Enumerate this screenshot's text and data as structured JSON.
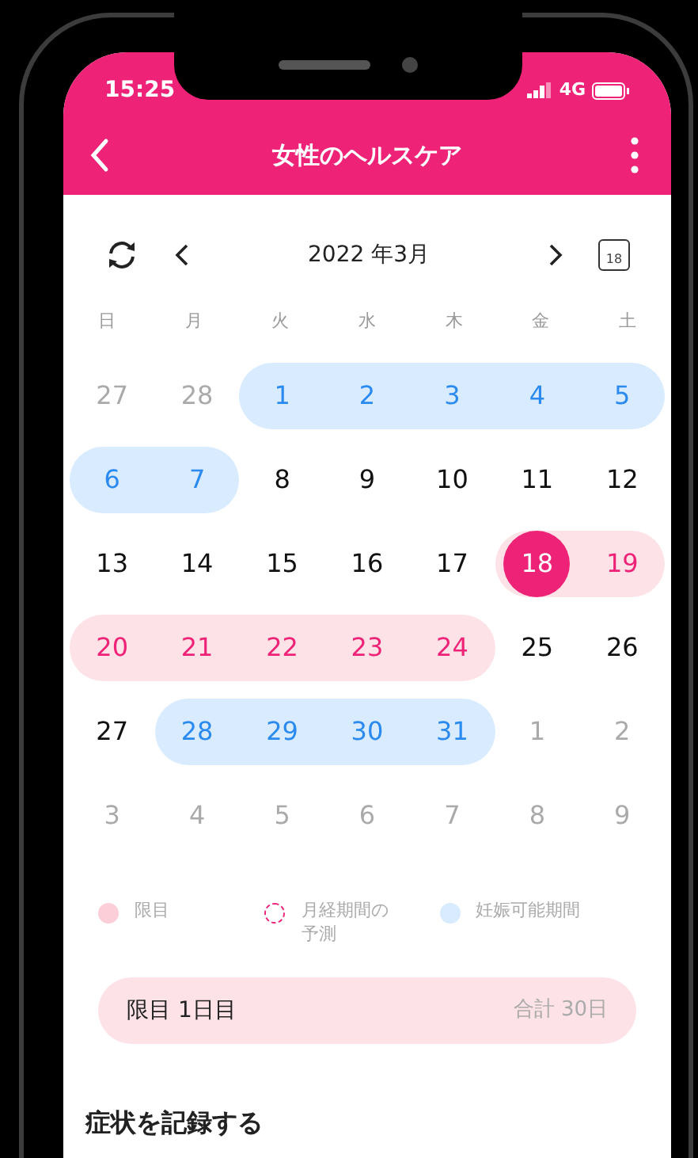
{
  "status_bar": {
    "time": "15:25",
    "network": "4G"
  },
  "header": {
    "title": "女性のヘルスケア"
  },
  "calendar": {
    "month": "2022 年3月",
    "today_icon": "18",
    "weekdays": [
      "日",
      "月",
      "火",
      "水",
      "木",
      "金",
      "土"
    ],
    "weeks": [
      [
        {
          "label": "27",
          "kind": "other",
          "selected": false
        },
        {
          "label": "28",
          "kind": "other",
          "selected": false
        },
        {
          "label": "1",
          "kind": "fertile",
          "selected": false
        },
        {
          "label": "2",
          "kind": "fertile",
          "selected": false
        },
        {
          "label": "3",
          "kind": "fertile",
          "selected": false
        },
        {
          "label": "4",
          "kind": "fertile",
          "selected": false
        },
        {
          "label": "5",
          "kind": "fertile",
          "selected": false
        }
      ],
      [
        {
          "label": "6",
          "kind": "fertile",
          "selected": false
        },
        {
          "label": "7",
          "kind": "fertile",
          "selected": false
        },
        {
          "label": "8",
          "kind": "normal",
          "selected": false
        },
        {
          "label": "9",
          "kind": "normal",
          "selected": false
        },
        {
          "label": "10",
          "kind": "normal",
          "selected": false
        },
        {
          "label": "11",
          "kind": "normal",
          "selected": false
        },
        {
          "label": "12",
          "kind": "normal",
          "selected": false
        }
      ],
      [
        {
          "label": "13",
          "kind": "normal",
          "selected": false
        },
        {
          "label": "14",
          "kind": "normal",
          "selected": false
        },
        {
          "label": "15",
          "kind": "normal",
          "selected": false
        },
        {
          "label": "16",
          "kind": "normal",
          "selected": false
        },
        {
          "label": "17",
          "kind": "normal",
          "selected": false
        },
        {
          "label": "18",
          "kind": "period",
          "selected": true
        },
        {
          "label": "19",
          "kind": "period",
          "selected": false
        }
      ],
      [
        {
          "label": "20",
          "kind": "period",
          "selected": false
        },
        {
          "label": "21",
          "kind": "period",
          "selected": false
        },
        {
          "label": "22",
          "kind": "period",
          "selected": false
        },
        {
          "label": "23",
          "kind": "period",
          "selected": false
        },
        {
          "label": "24",
          "kind": "period",
          "selected": false
        },
        {
          "label": "25",
          "kind": "normal",
          "selected": false
        },
        {
          "label": "26",
          "kind": "normal",
          "selected": false
        }
      ],
      [
        {
          "label": "27",
          "kind": "normal",
          "selected": false
        },
        {
          "label": "28",
          "kind": "fertile",
          "selected": false
        },
        {
          "label": "29",
          "kind": "fertile",
          "selected": false
        },
        {
          "label": "30",
          "kind": "fertile",
          "selected": false
        },
        {
          "label": "31",
          "kind": "fertile",
          "selected": false
        },
        {
          "label": "1",
          "kind": "other",
          "selected": false
        },
        {
          "label": "2",
          "kind": "other",
          "selected": false
        }
      ],
      [
        {
          "label": "3",
          "kind": "other",
          "selected": false
        },
        {
          "label": "4",
          "kind": "other",
          "selected": false
        },
        {
          "label": "5",
          "kind": "other",
          "selected": false
        },
        {
          "label": "6",
          "kind": "other",
          "selected": false
        },
        {
          "label": "7",
          "kind": "other",
          "selected": false
        },
        {
          "label": "8",
          "kind": "other",
          "selected": false
        },
        {
          "label": "9",
          "kind": "other",
          "selected": false
        }
      ]
    ]
  },
  "legend": [
    {
      "kind": "period",
      "label": "限目"
    },
    {
      "kind": "predicted",
      "label": "月経期間の予測"
    },
    {
      "kind": "fertile",
      "label": "妊娠可能期間"
    }
  ],
  "summary": {
    "label": "限目 1日目",
    "total": "合計 30日"
  },
  "section_title": "症状を記録する"
}
